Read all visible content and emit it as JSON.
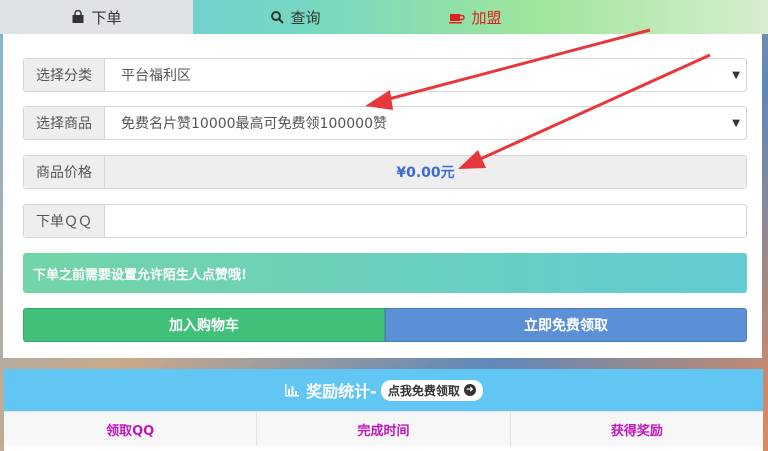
{
  "tabs": [
    {
      "label": "下单",
      "icon": "shopping-bag-icon"
    },
    {
      "label": "查询",
      "icon": "search-icon"
    },
    {
      "label": "加盟",
      "icon": "coffee-cup-icon"
    }
  ],
  "form": {
    "category": {
      "label": "选择分类",
      "value": "平台福利区"
    },
    "product": {
      "label": "选择商品",
      "value": "免费名片赞10000最高可免费领100000赞"
    },
    "price": {
      "label": "商品价格",
      "value": "¥0.00元"
    },
    "qq": {
      "label": "下单ＱＱ",
      "value": ""
    }
  },
  "notice": "下单之前需要设置允许陌生人点赞哦!",
  "buttons": {
    "add_to_cart": "加入购物车",
    "claim_free": "立即免费领取"
  },
  "stats": {
    "title": "奖励统计-",
    "pill": "点我免费领取",
    "columns": [
      "领取QQ",
      "完成时间",
      "获得奖励"
    ]
  },
  "colors": {
    "accent": "#3c6ccf",
    "join": "#e02020",
    "annotation": "#e8373a",
    "stats_header": "#62c6f4",
    "column_text": "#c018c0"
  }
}
